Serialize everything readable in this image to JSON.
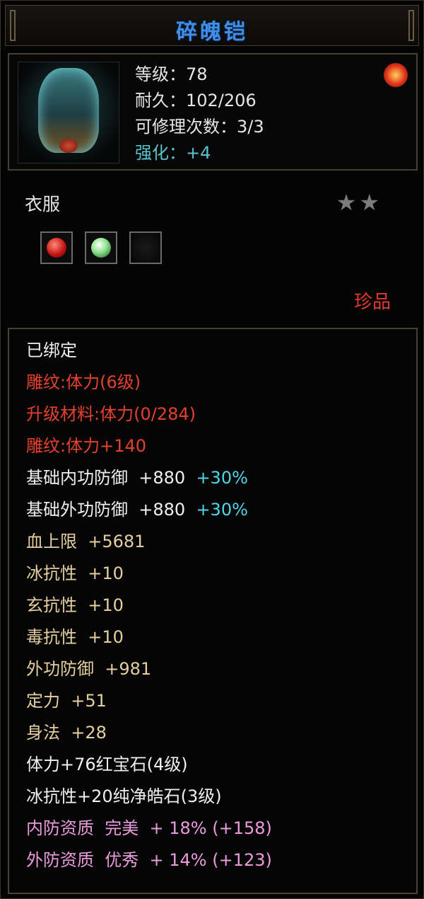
{
  "item": {
    "name": "碎魄铠",
    "icon": "armor-chest-icon",
    "badge_icon": "fire-rune-icon",
    "stats": [
      {
        "label": "等级",
        "value": "78"
      },
      {
        "label": "耐久",
        "value": "102/206"
      },
      {
        "label": "可修理次数",
        "value": "3/3"
      },
      {
        "label": "强化",
        "value": "+4"
      }
    ],
    "separator": "：",
    "type": "衣服",
    "stars": "★★",
    "star_count": 2,
    "sockets": [
      {
        "gem": "ruby-gem-icon"
      },
      {
        "gem": "pure-stone-icon"
      },
      {
        "gem": "empty-socket"
      }
    ],
    "rarity": "珍品"
  },
  "attributes": [
    {
      "text": "已绑定",
      "color": "white"
    },
    {
      "text": "雕纹:体力(6级)",
      "color": "red"
    },
    {
      "text": "升级材料:体力(0/284)",
      "color": "red"
    },
    {
      "text": "雕纹:体力+140",
      "color": "red"
    },
    {
      "text": "基础内功防御  +880",
      "extra": "+30%",
      "color": "white"
    },
    {
      "text": "基础外功防御  +880",
      "extra": "+30%",
      "color": "white"
    },
    {
      "text": "血上限  +5681",
      "color": "gold"
    },
    {
      "text": "冰抗性  +10",
      "color": "gold"
    },
    {
      "text": "玄抗性  +10",
      "color": "gold"
    },
    {
      "text": "毒抗性  +10",
      "color": "gold"
    },
    {
      "text": "外功防御  +981",
      "color": "gold"
    },
    {
      "text": "定力  +51",
      "color": "gold"
    },
    {
      "text": "身法  +28",
      "color": "gold"
    },
    {
      "text": "体力+76红宝石(4级)",
      "color": "white"
    },
    {
      "text": "冰抗性+20纯净皓石(3级)",
      "color": "white"
    },
    {
      "text": "内防资质  完美  + 18% (+158)",
      "color": "pink"
    },
    {
      "text": "外防资质  优秀  + 14% (+123)",
      "color": "pink"
    }
  ]
}
